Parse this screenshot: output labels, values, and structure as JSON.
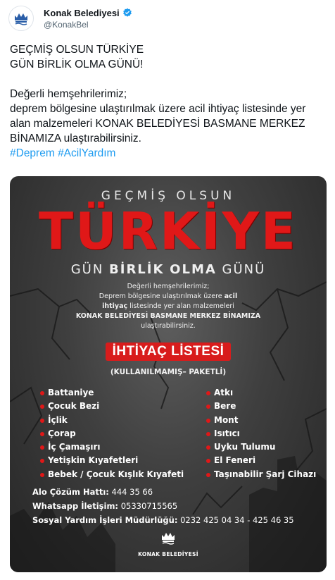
{
  "account": {
    "display_name": "Konak Belediyesi",
    "handle": "@KonakBel",
    "avatar_icon": "konak-crest-icon",
    "verified_icon": "verified-badge-icon",
    "verified_color": "#1d9bf0"
  },
  "tweet": {
    "line1": "GEÇMİŞ OLSUN TÜRKİYE",
    "line2": "GÜN BİRLİK OLMA GÜNÜ!",
    "line3": "Değerli hemşehrilerimiz;",
    "line4": "deprem bölgesine ulaştırılmak üzere acil ihtiyaç listesinde yer alan malzemeleri KONAK BELEDİYESİ BASMANE MERKEZ BİNAMIZA ulaştırabilirsiniz.",
    "hashtag1": "#Deprem",
    "hashtag2": "#AcilYardım",
    "link_color": "#1d9bf0"
  },
  "poster": {
    "title_top": "GEÇMİŞ OLSUN",
    "title_main": "TÜRKİYE",
    "title_main_color": "#e01818",
    "subtitle_a": "GÜN",
    "subtitle_b": "BİRLİK",
    "subtitle_c": "OLMA",
    "subtitle_d": "GÜNÜ",
    "intro_1": "Değerli hemşehrilerimiz;",
    "intro_2a": "Deprem bölgesine ulaştırılmak üzere",
    "intro_2b": "acil",
    "intro_3a": "ihtiyaç",
    "intro_3b": "listesinde yer alan malzemeleri",
    "intro_4": "KONAK BELEDİYESİ BASMANE MERKEZ BİNAMIZA",
    "intro_5": "ulaştırabilirsiniz.",
    "list_title": "İHTİYAÇ LİSTESİ",
    "list_note": "(KULLANILMAMIŞ– PAKETLİ)",
    "items_left": [
      "Battaniye",
      "Çocuk Bezi",
      "İçlik",
      "Çorap",
      "İç Çamaşırı",
      "Yetişkin Kıyafetleri",
      "Bebek / Çocuk Kışlık Kıyafeti"
    ],
    "items_right": [
      "Atkı",
      "Bere",
      "Mont",
      "Isıtıcı",
      "Uyku Tulumu",
      "El Feneri",
      "Taşınabilir Şarj Cihazı"
    ],
    "contact_1_label": "Alo Çözüm Hattı:",
    "contact_1_value": "444 35 66",
    "contact_2_label": "Whatsapp İletişim:",
    "contact_2_value": "05330715565",
    "contact_3_label": "Sosyal Yardım İşleri Müdürlüğü:",
    "contact_3_value": "0232 425 04 34 - 425 46 35",
    "logo_text": "KONAK BELEDİYESİ"
  }
}
